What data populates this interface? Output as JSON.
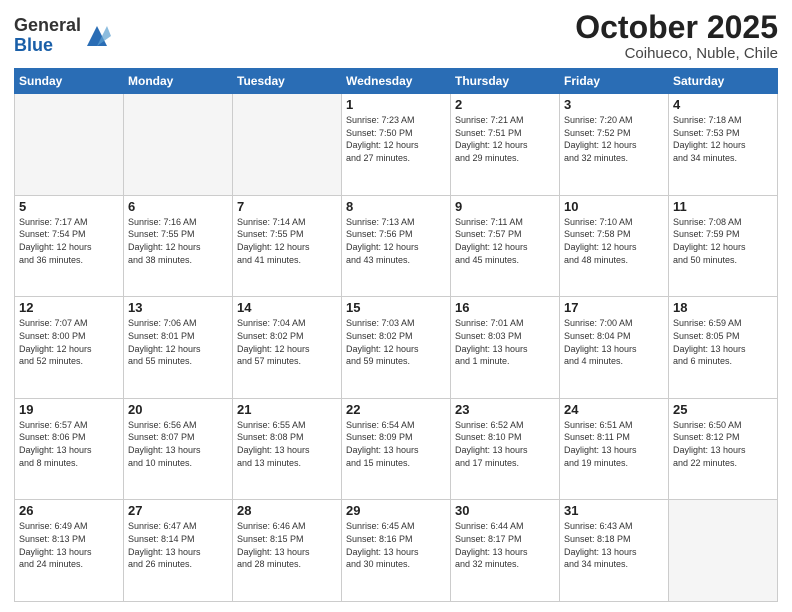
{
  "header": {
    "logo_general": "General",
    "logo_blue": "Blue",
    "title": "October 2025",
    "subtitle": "Coihueco, Nuble, Chile"
  },
  "days_of_week": [
    "Sunday",
    "Monday",
    "Tuesday",
    "Wednesday",
    "Thursday",
    "Friday",
    "Saturday"
  ],
  "weeks": [
    [
      {
        "day": "",
        "info": ""
      },
      {
        "day": "",
        "info": ""
      },
      {
        "day": "",
        "info": ""
      },
      {
        "day": "1",
        "info": "Sunrise: 7:23 AM\nSunset: 7:50 PM\nDaylight: 12 hours\nand 27 minutes."
      },
      {
        "day": "2",
        "info": "Sunrise: 7:21 AM\nSunset: 7:51 PM\nDaylight: 12 hours\nand 29 minutes."
      },
      {
        "day": "3",
        "info": "Sunrise: 7:20 AM\nSunset: 7:52 PM\nDaylight: 12 hours\nand 32 minutes."
      },
      {
        "day": "4",
        "info": "Sunrise: 7:18 AM\nSunset: 7:53 PM\nDaylight: 12 hours\nand 34 minutes."
      }
    ],
    [
      {
        "day": "5",
        "info": "Sunrise: 7:17 AM\nSunset: 7:54 PM\nDaylight: 12 hours\nand 36 minutes."
      },
      {
        "day": "6",
        "info": "Sunrise: 7:16 AM\nSunset: 7:55 PM\nDaylight: 12 hours\nand 38 minutes."
      },
      {
        "day": "7",
        "info": "Sunrise: 7:14 AM\nSunset: 7:55 PM\nDaylight: 12 hours\nand 41 minutes."
      },
      {
        "day": "8",
        "info": "Sunrise: 7:13 AM\nSunset: 7:56 PM\nDaylight: 12 hours\nand 43 minutes."
      },
      {
        "day": "9",
        "info": "Sunrise: 7:11 AM\nSunset: 7:57 PM\nDaylight: 12 hours\nand 45 minutes."
      },
      {
        "day": "10",
        "info": "Sunrise: 7:10 AM\nSunset: 7:58 PM\nDaylight: 12 hours\nand 48 minutes."
      },
      {
        "day": "11",
        "info": "Sunrise: 7:08 AM\nSunset: 7:59 PM\nDaylight: 12 hours\nand 50 minutes."
      }
    ],
    [
      {
        "day": "12",
        "info": "Sunrise: 7:07 AM\nSunset: 8:00 PM\nDaylight: 12 hours\nand 52 minutes."
      },
      {
        "day": "13",
        "info": "Sunrise: 7:06 AM\nSunset: 8:01 PM\nDaylight: 12 hours\nand 55 minutes."
      },
      {
        "day": "14",
        "info": "Sunrise: 7:04 AM\nSunset: 8:02 PM\nDaylight: 12 hours\nand 57 minutes."
      },
      {
        "day": "15",
        "info": "Sunrise: 7:03 AM\nSunset: 8:02 PM\nDaylight: 12 hours\nand 59 minutes."
      },
      {
        "day": "16",
        "info": "Sunrise: 7:01 AM\nSunset: 8:03 PM\nDaylight: 13 hours\nand 1 minute."
      },
      {
        "day": "17",
        "info": "Sunrise: 7:00 AM\nSunset: 8:04 PM\nDaylight: 13 hours\nand 4 minutes."
      },
      {
        "day": "18",
        "info": "Sunrise: 6:59 AM\nSunset: 8:05 PM\nDaylight: 13 hours\nand 6 minutes."
      }
    ],
    [
      {
        "day": "19",
        "info": "Sunrise: 6:57 AM\nSunset: 8:06 PM\nDaylight: 13 hours\nand 8 minutes."
      },
      {
        "day": "20",
        "info": "Sunrise: 6:56 AM\nSunset: 8:07 PM\nDaylight: 13 hours\nand 10 minutes."
      },
      {
        "day": "21",
        "info": "Sunrise: 6:55 AM\nSunset: 8:08 PM\nDaylight: 13 hours\nand 13 minutes."
      },
      {
        "day": "22",
        "info": "Sunrise: 6:54 AM\nSunset: 8:09 PM\nDaylight: 13 hours\nand 15 minutes."
      },
      {
        "day": "23",
        "info": "Sunrise: 6:52 AM\nSunset: 8:10 PM\nDaylight: 13 hours\nand 17 minutes."
      },
      {
        "day": "24",
        "info": "Sunrise: 6:51 AM\nSunset: 8:11 PM\nDaylight: 13 hours\nand 19 minutes."
      },
      {
        "day": "25",
        "info": "Sunrise: 6:50 AM\nSunset: 8:12 PM\nDaylight: 13 hours\nand 22 minutes."
      }
    ],
    [
      {
        "day": "26",
        "info": "Sunrise: 6:49 AM\nSunset: 8:13 PM\nDaylight: 13 hours\nand 24 minutes."
      },
      {
        "day": "27",
        "info": "Sunrise: 6:47 AM\nSunset: 8:14 PM\nDaylight: 13 hours\nand 26 minutes."
      },
      {
        "day": "28",
        "info": "Sunrise: 6:46 AM\nSunset: 8:15 PM\nDaylight: 13 hours\nand 28 minutes."
      },
      {
        "day": "29",
        "info": "Sunrise: 6:45 AM\nSunset: 8:16 PM\nDaylight: 13 hours\nand 30 minutes."
      },
      {
        "day": "30",
        "info": "Sunrise: 6:44 AM\nSunset: 8:17 PM\nDaylight: 13 hours\nand 32 minutes."
      },
      {
        "day": "31",
        "info": "Sunrise: 6:43 AM\nSunset: 8:18 PM\nDaylight: 13 hours\nand 34 minutes."
      },
      {
        "day": "",
        "info": ""
      }
    ]
  ]
}
